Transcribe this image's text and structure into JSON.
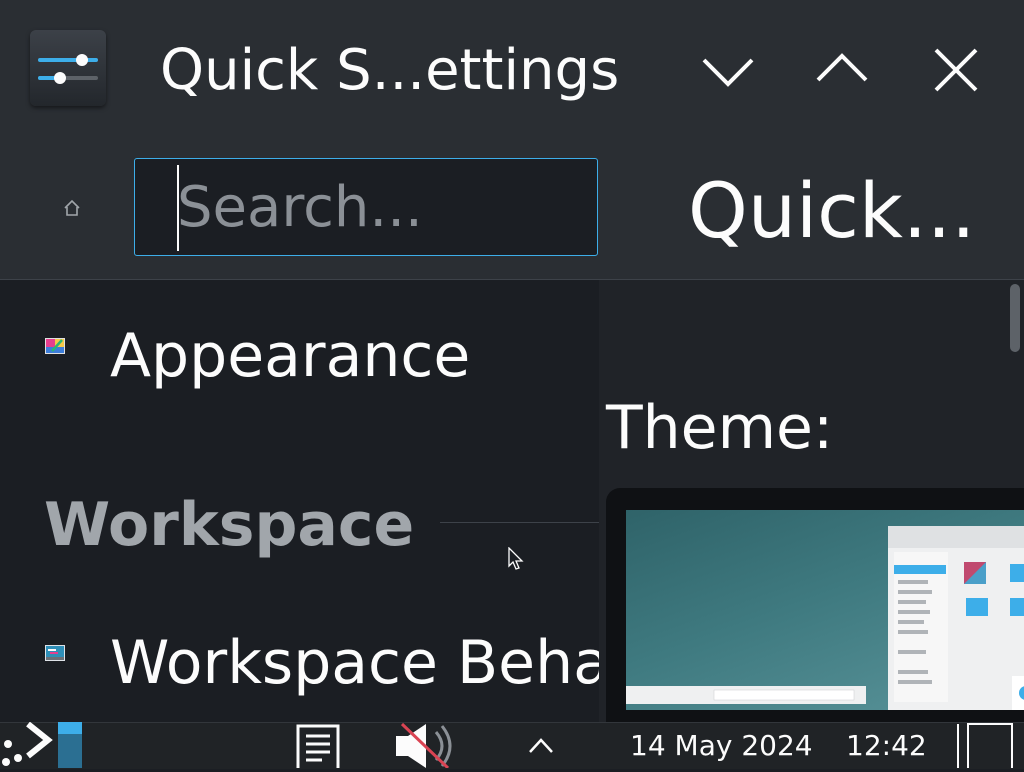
{
  "window": {
    "title": "Quick S...ettings",
    "app_icon": "settings-sliders-icon",
    "controls": [
      "minimize-icon",
      "maximize-icon",
      "close-icon"
    ]
  },
  "toolbar": {
    "home_icon": "home-icon",
    "search_placeholder": "Search...",
    "search_value": "",
    "page_heading": "Quick..."
  },
  "sidebar": {
    "items": [
      {
        "label": "Appearance",
        "icon": "appearance-icon"
      },
      {
        "label": "Workspace Beha",
        "icon": "workspace-behavior-icon"
      }
    ],
    "sections": [
      {
        "title": "Workspace"
      }
    ]
  },
  "content": {
    "theme_label": "Theme:",
    "preview": "theme-preview"
  },
  "taskbar": {
    "date": "14 May 2024",
    "time": "12:42",
    "icons": [
      "app-launcher-icon",
      "clipboard-icon",
      "volume-muted-icon",
      "tray-expand-icon",
      "show-desktop-icon"
    ]
  },
  "colors": {
    "accent": "#3daee9",
    "window_bg": "#2a2e33",
    "view_bg": "#1b1e23",
    "text": "#fcfcfc",
    "muted_text": "#a1a6ab"
  }
}
